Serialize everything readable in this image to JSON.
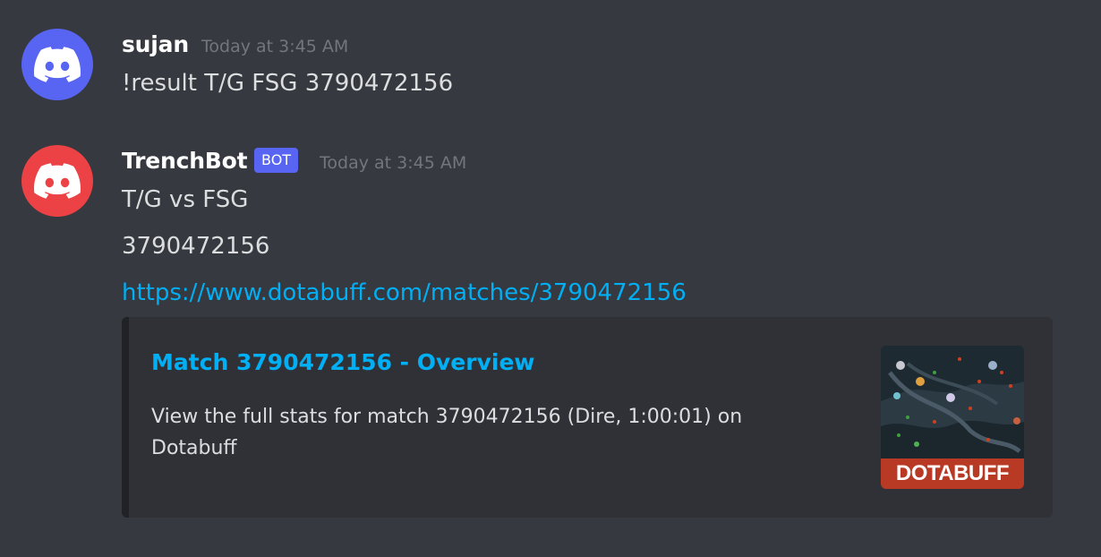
{
  "messages": [
    {
      "author": "sujan",
      "timestamp": "Today at 3:45 AM",
      "avatar_color": "#5865f2",
      "avatar_icon": "discord-logo-icon",
      "text": "!result T/G FSG 3790472156"
    },
    {
      "author": "TrenchBot",
      "badge": "BOT",
      "timestamp": "Today at 3:45 AM",
      "avatar_color": "#ed4245",
      "avatar_icon": "discord-logo-icon",
      "lines": [
        "T/G vs FSG",
        "3790472156"
      ],
      "link": "https://www.dotabuff.com/matches/3790472156",
      "embed": {
        "title": "Match 3790472156 - Overview",
        "description": "View the full stats for match 3790472156 (Dire, 1:00:01) on Dotabuff",
        "thumbnail_caption": "DOTABUFF",
        "thumbnail_icon": "dota-minimap-icon",
        "thumbnail_color": "#b83a25"
      }
    }
  ],
  "colors": {
    "background": "#36393f",
    "embed_background": "#2f3136",
    "link": "#00aff4",
    "badge": "#5865f2"
  }
}
